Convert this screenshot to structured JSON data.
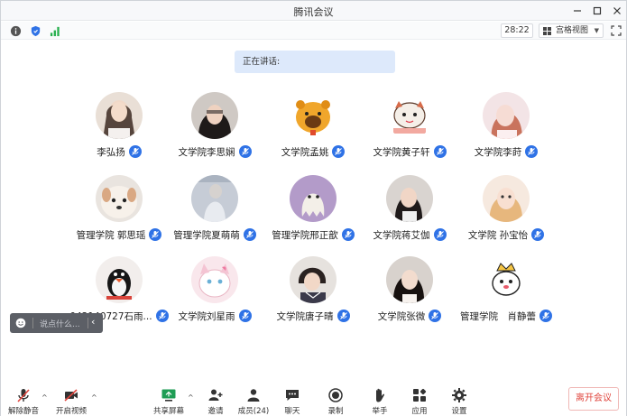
{
  "window": {
    "title": "腾讯会议"
  },
  "infobar": {
    "timer": "28:22",
    "view_label": "宫格视图"
  },
  "speaking": {
    "label": "正在讲话:"
  },
  "participants": [
    {
      "name": "李弘扬",
      "avatar": "avatar-1"
    },
    {
      "name": "文学院李思娴",
      "avatar": "avatar-2"
    },
    {
      "name": "文学院孟姚",
      "avatar": "avatar-3"
    },
    {
      "name": "文学院黄子轩",
      "avatar": "avatar-4"
    },
    {
      "name": "文学院李莳",
      "avatar": "avatar-5"
    },
    {
      "name": "管理学院 郭思瑶",
      "avatar": "avatar-6"
    },
    {
      "name": "管理学院夏萌萌",
      "avatar": "avatar-7"
    },
    {
      "name": "管理学院邢正歆",
      "avatar": "avatar-8"
    },
    {
      "name": "文学院蒋艾伽",
      "avatar": "avatar-9"
    },
    {
      "name": "文学院 孙宝怡",
      "avatar": "avatar-10"
    },
    {
      "name": "042140727石雨...",
      "avatar": "avatar-11"
    },
    {
      "name": "文学院刘星雨",
      "avatar": "avatar-12"
    },
    {
      "name": "文学院唐子晴",
      "avatar": "avatar-13"
    },
    {
      "name": "文学院张微",
      "avatar": "avatar-14"
    },
    {
      "name": "管理学院　肖静蕾",
      "avatar": "avatar-15"
    }
  ],
  "chat": {
    "placeholder": "说点什么..."
  },
  "toolbar": {
    "unmute": "解除静音",
    "start_video": "开启视频",
    "share_screen": "共享屏幕",
    "invite": "邀请",
    "members": "成员(24)",
    "chat": "聊天",
    "record": "录制",
    "raise_hand": "举手",
    "apps": "应用",
    "settings": "设置",
    "leave": "离开会议"
  },
  "colors": {
    "accent": "#2f72e6",
    "leave": "#e0453d",
    "speaking_bg": "#dde9fb"
  }
}
